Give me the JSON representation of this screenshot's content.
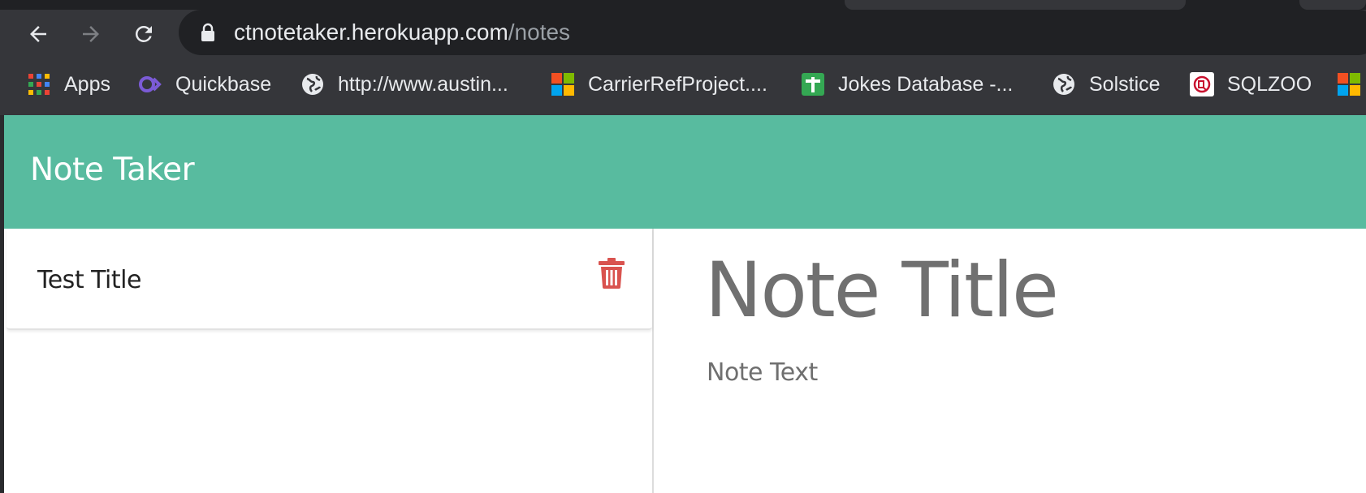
{
  "browser": {
    "address_bar": {
      "host": "ctnotetaker.herokuapp.com",
      "path": "/notes"
    },
    "bookmarks": [
      {
        "label": "Apps",
        "icon": "apps-grid-icon"
      },
      {
        "label": "Quickbase",
        "icon": "quickbase-icon"
      },
      {
        "label": "http://www.austin...",
        "icon": "globe-icon"
      },
      {
        "label": "CarrierRefProject....",
        "icon": "microsoft-icon"
      },
      {
        "label": "Jokes Database -...",
        "icon": "sheets-icon"
      },
      {
        "label": "Solstice",
        "icon": "globe-icon"
      },
      {
        "label": "SQLZOO",
        "icon": "sqlzoo-icon"
      },
      {
        "label": "",
        "icon": "microsoft-icon"
      }
    ]
  },
  "app": {
    "brand": "Note Taker",
    "accent_color": "#58bb9f",
    "notes": [
      {
        "title": "Test Title",
        "delete_icon": "trash-icon",
        "delete_color": "#d9534f"
      }
    ],
    "editor": {
      "title_placeholder": "Note Title",
      "text_placeholder": "Note Text"
    }
  }
}
